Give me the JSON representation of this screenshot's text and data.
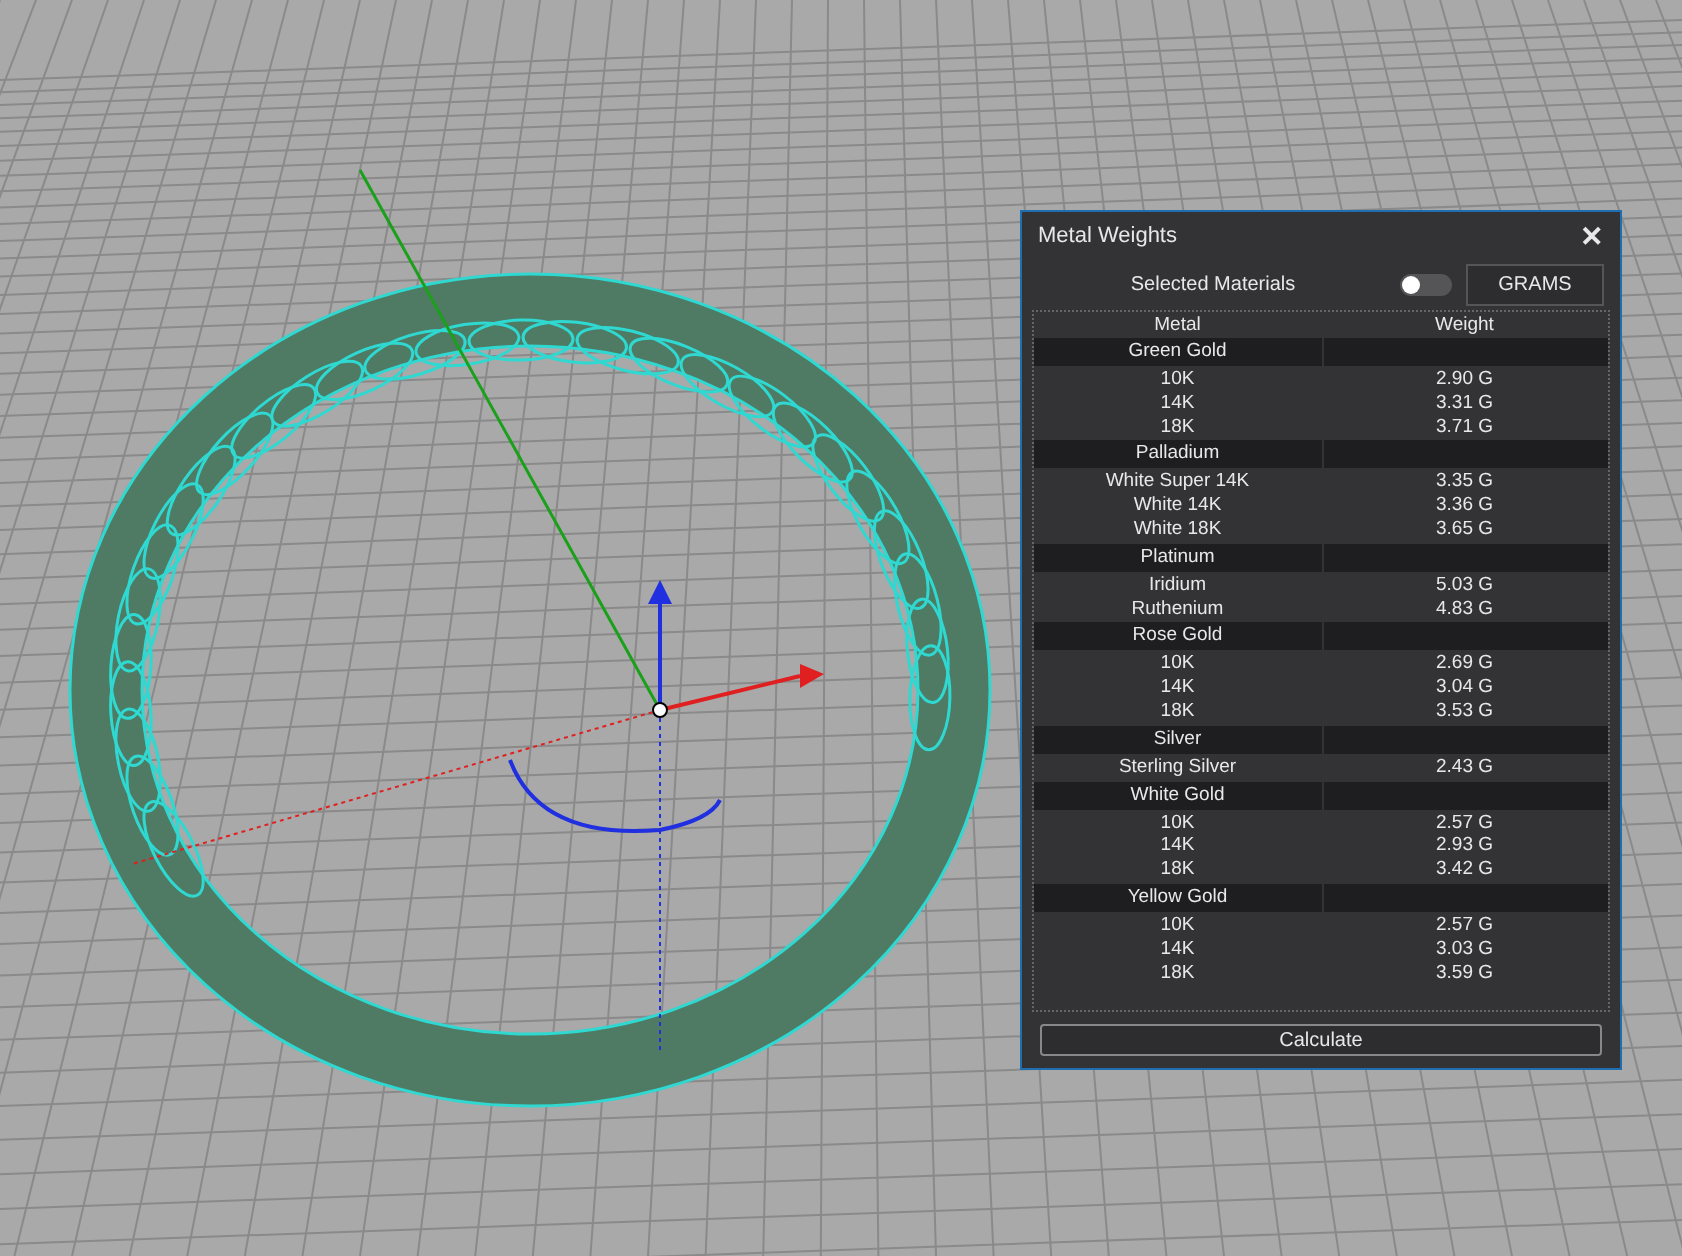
{
  "panel": {
    "title": "Metal Weights",
    "close": "✕",
    "selected_materials": {
      "label": "Selected Materials",
      "on": false
    },
    "unit_button": "GRAMS",
    "table": {
      "columns": [
        "Metal",
        "Weight"
      ],
      "groups": [
        {
          "name": "Green Gold",
          "rows": [
            {
              "metal": "10K",
              "weight": "2.90 G"
            },
            {
              "metal": "14K",
              "weight": "3.31 G"
            },
            {
              "metal": "18K",
              "weight": "3.71 G"
            }
          ]
        },
        {
          "name": "Palladium",
          "rows": [
            {
              "metal": "White Super 14K",
              "weight": "3.35 G"
            },
            {
              "metal": "White 14K",
              "weight": "3.36 G"
            },
            {
              "metal": "White 18K",
              "weight": "3.65 G"
            }
          ]
        },
        {
          "name": "Platinum",
          "rows": [
            {
              "metal": "Iridium",
              "weight": "5.03 G"
            },
            {
              "metal": "Ruthenium",
              "weight": "4.83 G"
            }
          ]
        },
        {
          "name": "Rose Gold",
          "rows": [
            {
              "metal": "10K",
              "weight": "2.69 G"
            },
            {
              "metal": "14K",
              "weight": "3.04 G"
            },
            {
              "metal": "18K",
              "weight": "3.53 G"
            }
          ]
        },
        {
          "name": "Silver",
          "rows": [
            {
              "metal": "Sterling Silver",
              "weight": "2.43 G"
            }
          ]
        },
        {
          "name": "White Gold",
          "rows": [
            {
              "metal": "10K",
              "weight": "2.57 G"
            },
            {
              "metal": "14K",
              "weight": "2.93 G"
            },
            {
              "metal": "18K",
              "weight": "3.42 G"
            }
          ]
        },
        {
          "name": "Yellow Gold",
          "rows": [
            {
              "metal": "10K",
              "weight": "2.57 G"
            },
            {
              "metal": "14K",
              "weight": "3.03 G"
            },
            {
              "metal": "18K",
              "weight": "3.59 G"
            }
          ]
        }
      ]
    },
    "calculate_button": "Calculate"
  }
}
